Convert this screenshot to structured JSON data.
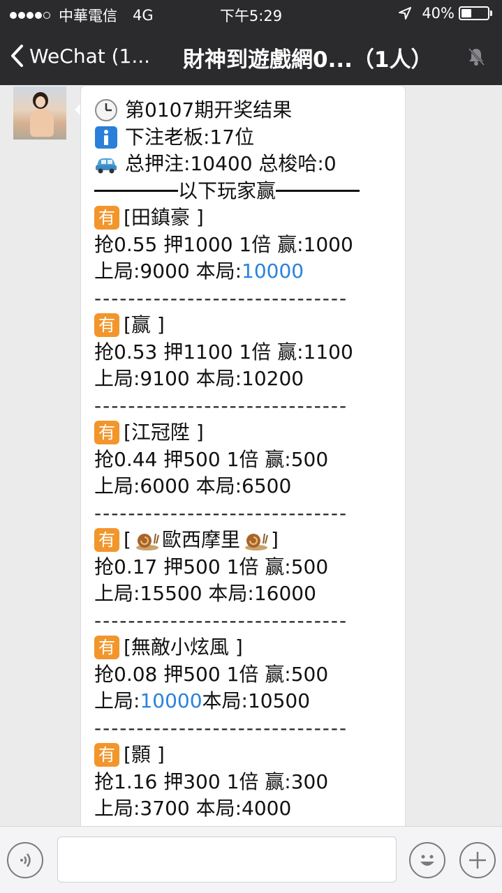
{
  "status_bar": {
    "carrier": "中華電信",
    "network": "4G",
    "time": "下午5:29",
    "battery": "40%",
    "battery_level": 0.4
  },
  "nav": {
    "back_label": "WeChat (1...",
    "title": "財神到遊戲網0...（1人）"
  },
  "message": {
    "header": {
      "period": "第0107期开奖结果",
      "bettors": "下注老板:17位",
      "totals": "总押注:10400 总梭哈:0",
      "divider_text": "以下玩家赢"
    },
    "separator": "------------------------------",
    "badge": "有",
    "players": [
      {
        "name": "[田鎮豪  ]",
        "stats": "抢0.55 押1000 1倍 赢:1000",
        "prev_label": "上局:9000 本局:",
        "prev_value": "",
        "curr_value": "10000"
      },
      {
        "name": "[赢     ]",
        "stats": "抢0.53 押1100 1倍 赢:1100",
        "prev_label": "上局:9100 本局:10200",
        "prev_value": "",
        "curr_value": ""
      },
      {
        "name": "[江冠陞  ]",
        "stats": "抢0.44 押500 1倍 赢:500",
        "prev_label": "上局:6000 本局:6500",
        "prev_value": "",
        "curr_value": ""
      },
      {
        "name_pre": "[",
        "name": "歐西摩里",
        "name_post": "]",
        "stats": "抢0.17 押500 1倍 赢:500",
        "prev_label": "上局:15500 本局:16000",
        "prev_value": "",
        "curr_value": ""
      },
      {
        "name": "[無敵小炫風 ]",
        "stats": "抢0.08 押500 1倍 赢:500",
        "prev_label": "上局:",
        "prev_value": "10000",
        "curr_label": " 本局:10500"
      },
      {
        "name": "[顥     ]",
        "stats": "抢1.16 押300 1倍 赢:300",
        "prev_label": "上局:3700 本局:4000",
        "prev_value": "",
        "curr_value": ""
      }
    ]
  },
  "colors": {
    "link": "#2a82dc",
    "badge": "#f2962c",
    "bar": "#2b2b2e"
  },
  "icons": [
    "clock-icon",
    "info-icon",
    "car-icon",
    "snail-icon",
    "location-arrow-icon",
    "mute-bell-icon",
    "voice-icon",
    "emoji-icon",
    "plus-icon",
    "back-chevron-icon"
  ]
}
